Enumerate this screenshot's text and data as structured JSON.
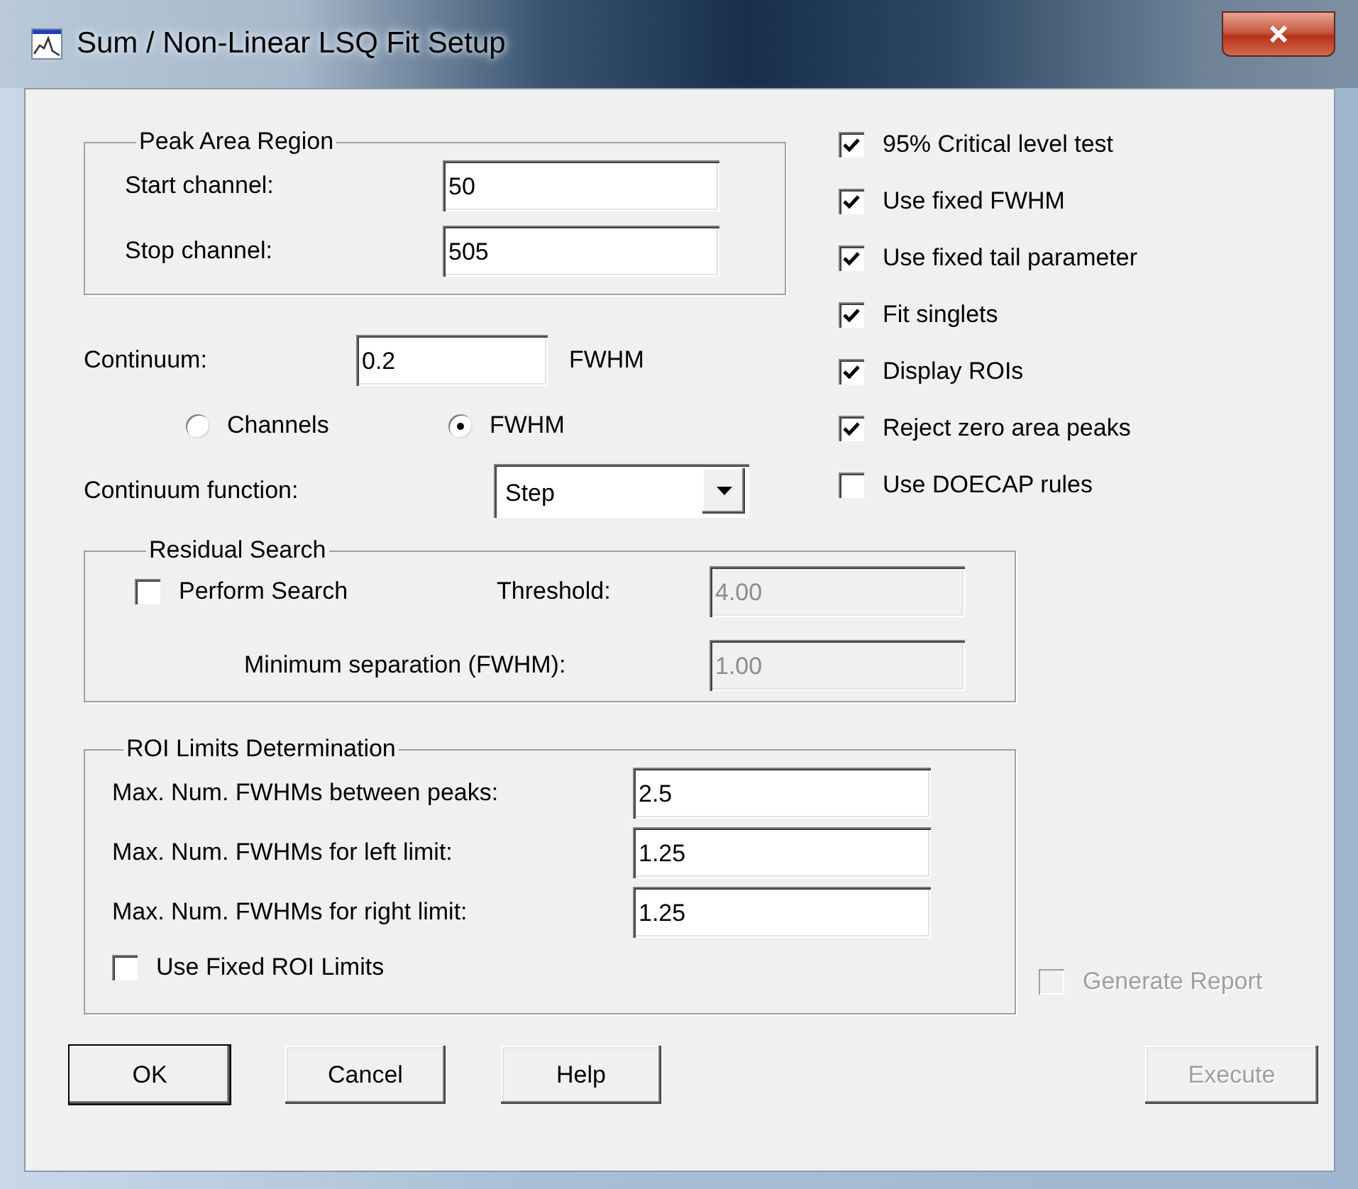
{
  "window": {
    "title": "Sum / Non-Linear LSQ Fit Setup"
  },
  "peak_area_region": {
    "title": "Peak Area Region",
    "fields": [
      {
        "label": "Start channel:",
        "value": "50"
      },
      {
        "label": "Stop channel:",
        "value": "505"
      }
    ]
  },
  "continuum": {
    "label": "Continuum:",
    "value": "0.2",
    "unit": "FWHM"
  },
  "continuum_units": [
    {
      "label": "Channels",
      "selected": false
    },
    {
      "label": "FWHM",
      "selected": true
    }
  ],
  "continuum_function": {
    "label": "Continuum function:",
    "value": "Step"
  },
  "residual_search": {
    "title": "Residual Search",
    "perform_search": {
      "label": "Perform Search",
      "checked": false
    },
    "threshold": {
      "label": "Threshold:",
      "value": "4.00",
      "disabled": true
    },
    "minimum_separation": {
      "label": "Minimum separation (FWHM):",
      "value": "1.00",
      "disabled": true
    }
  },
  "roi_limits": {
    "title": "ROI Limits Determination",
    "fields": [
      {
        "label": "Max. Num. FWHMs between peaks:",
        "value": "2.5"
      },
      {
        "label": "Max. Num. FWHMs for left limit:",
        "value": "1.25"
      },
      {
        "label": "Max. Num. FWHMs for right limit:",
        "value": "1.25"
      }
    ],
    "fixed_limits": {
      "label": "Use Fixed ROI Limits",
      "checked": false
    }
  },
  "options": [
    {
      "label": "95% Critical level test",
      "checked": true
    },
    {
      "label": "Use fixed FWHM",
      "checked": true
    },
    {
      "label": "Use fixed tail parameter",
      "checked": true
    },
    {
      "label": "Fit singlets",
      "checked": true
    },
    {
      "label": "Display ROIs",
      "checked": true
    },
    {
      "label": "Reject zero area peaks",
      "checked": true
    },
    {
      "label": "Use DOECAP rules",
      "checked": false
    }
  ],
  "generate_report": {
    "label": "Generate Report",
    "checked": false,
    "disabled": true
  },
  "buttons": [
    {
      "label": "OK",
      "disabled": false
    },
    {
      "label": "Cancel",
      "disabled": false
    },
    {
      "label": "Help",
      "disabled": false
    },
    {
      "label": "Execute",
      "disabled": true
    }
  ]
}
